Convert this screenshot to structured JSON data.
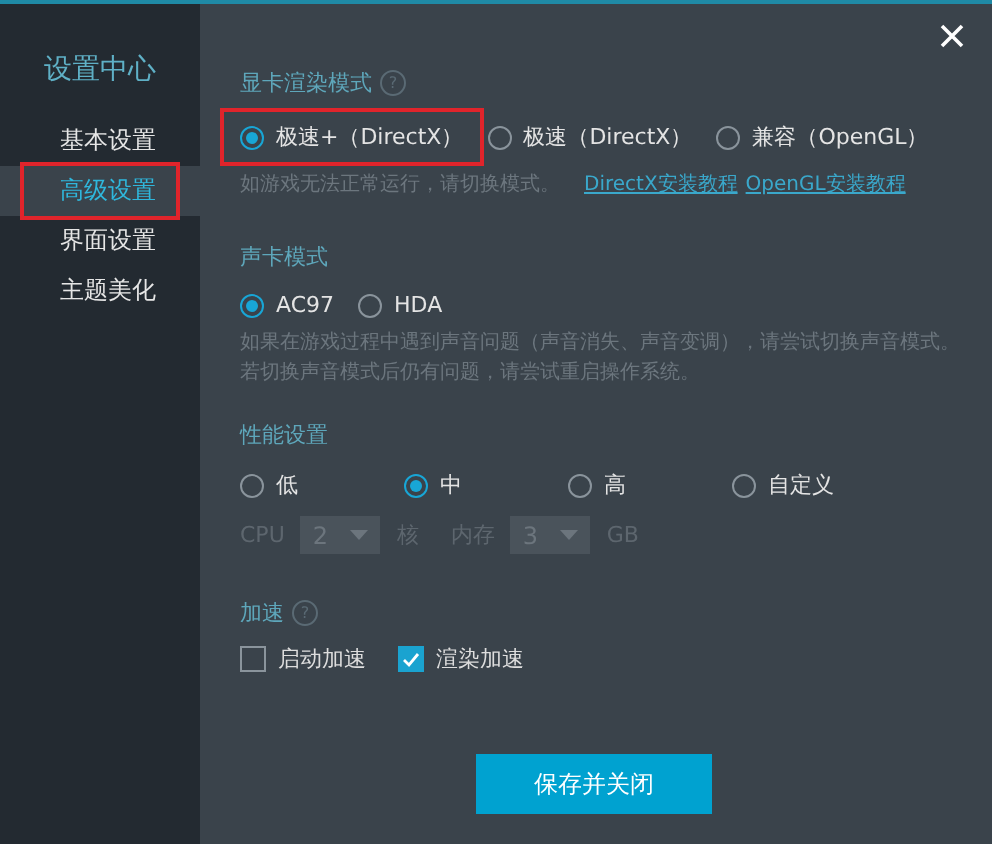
{
  "sidebar": {
    "title": "设置中心",
    "items": [
      {
        "label": "基本设置",
        "selected": false,
        "highlighted": false
      },
      {
        "label": "高级设置",
        "selected": true,
        "highlighted": true
      },
      {
        "label": "界面设置",
        "selected": false,
        "highlighted": false
      },
      {
        "label": "主题美化",
        "selected": false,
        "highlighted": false
      }
    ]
  },
  "render": {
    "title": "显卡渲染模式",
    "help": "?",
    "options": [
      {
        "label": "极速+（DirectX）",
        "selected": true,
        "highlighted": true
      },
      {
        "label": "极速（DirectX）",
        "selected": false,
        "highlighted": false
      },
      {
        "label": "兼容（OpenGL）",
        "selected": false,
        "highlighted": false
      }
    ],
    "hint": "如游戏无法正常运行，请切换模式。",
    "links": [
      "DirectX安装教程",
      "OpenGL安装教程"
    ]
  },
  "sound": {
    "title": "声卡模式",
    "options": [
      {
        "label": "AC97",
        "selected": true
      },
      {
        "label": "HDA",
        "selected": false
      }
    ],
    "hint_lines": [
      "如果在游戏过程中遇到声音问题（声音消失、声音变调），请尝试切换声音模式。",
      "若切换声音模式后仍有问题，请尝试重启操作系统。"
    ]
  },
  "performance": {
    "title": "性能设置",
    "options": [
      {
        "label": "低",
        "selected": false
      },
      {
        "label": "中",
        "selected": true
      },
      {
        "label": "高",
        "selected": false
      },
      {
        "label": "自定义",
        "selected": false
      }
    ],
    "custom": {
      "disabled": true,
      "cpu_label": "CPU",
      "cpu_value": "2",
      "cpu_unit": "核",
      "memory_label": "内存",
      "memory_value": "3",
      "memory_unit": "GB"
    }
  },
  "acceleration": {
    "title": "加速",
    "help": "?",
    "checkboxes": [
      {
        "label": "启动加速",
        "checked": false
      },
      {
        "label": "渲染加速",
        "checked": true
      }
    ]
  },
  "save_button": "保存并关闭"
}
